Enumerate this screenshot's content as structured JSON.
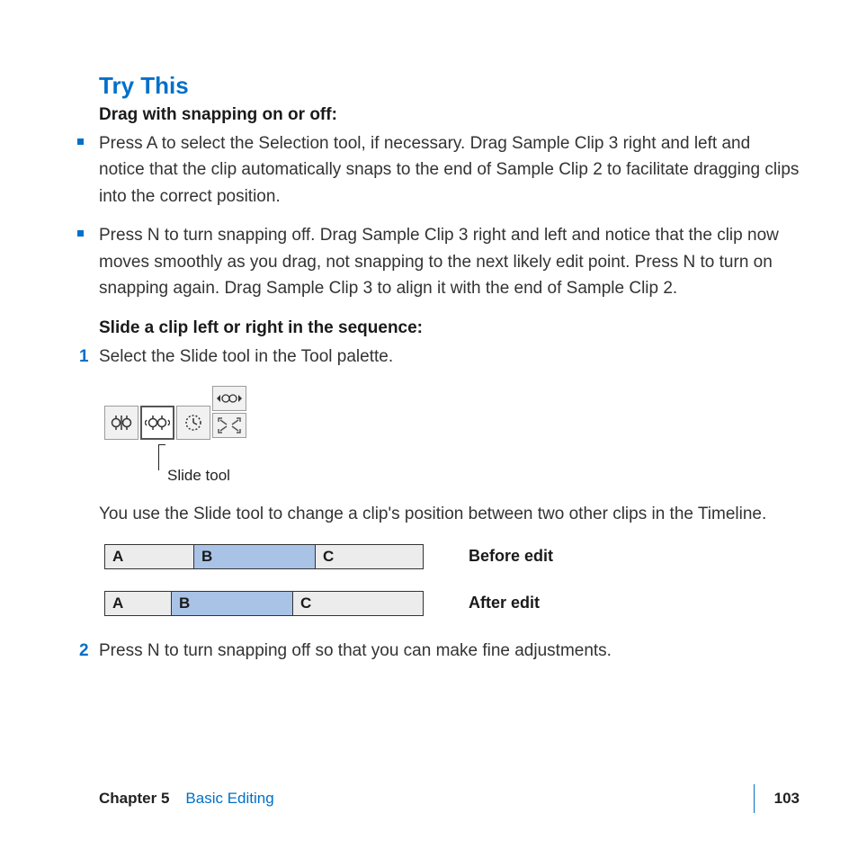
{
  "heading": "Try This",
  "sub1": "Drag with snapping on or off:",
  "bullets": [
    "Press A to select the Selection tool, if necessary. Drag Sample Clip 3 right and left and notice that the clip automatically snaps to the end of Sample Clip 2 to facilitate dragging clips into the correct position.",
    "Press N to turn snapping off. Drag Sample Clip 3 right and left and notice that the clip now moves smoothly as you drag, not snapping to the next likely edit point. Press N to turn on snapping again. Drag Sample Clip 3 to align it with the end of Sample Clip 2."
  ],
  "sub2": "Slide a clip left or right in the sequence:",
  "step1_num": "1",
  "step1_text": "Select the Slide tool in the Tool palette.",
  "slide_tool_label": "Slide tool",
  "para_after_tool": "You use the Slide tool to change a clip's position between two other clips in the Timeline.",
  "diagram": {
    "before": {
      "A": "A",
      "B": "B",
      "C": "C",
      "label": "Before edit"
    },
    "after": {
      "A": "A",
      "B": "B",
      "C": "C",
      "label": "After edit"
    }
  },
  "step2_num": "2",
  "step2_text": "Press N to turn snapping off so that you can make fine adjustments.",
  "footer": {
    "chapter": "Chapter 5",
    "title": "Basic Editing",
    "page": "103"
  }
}
